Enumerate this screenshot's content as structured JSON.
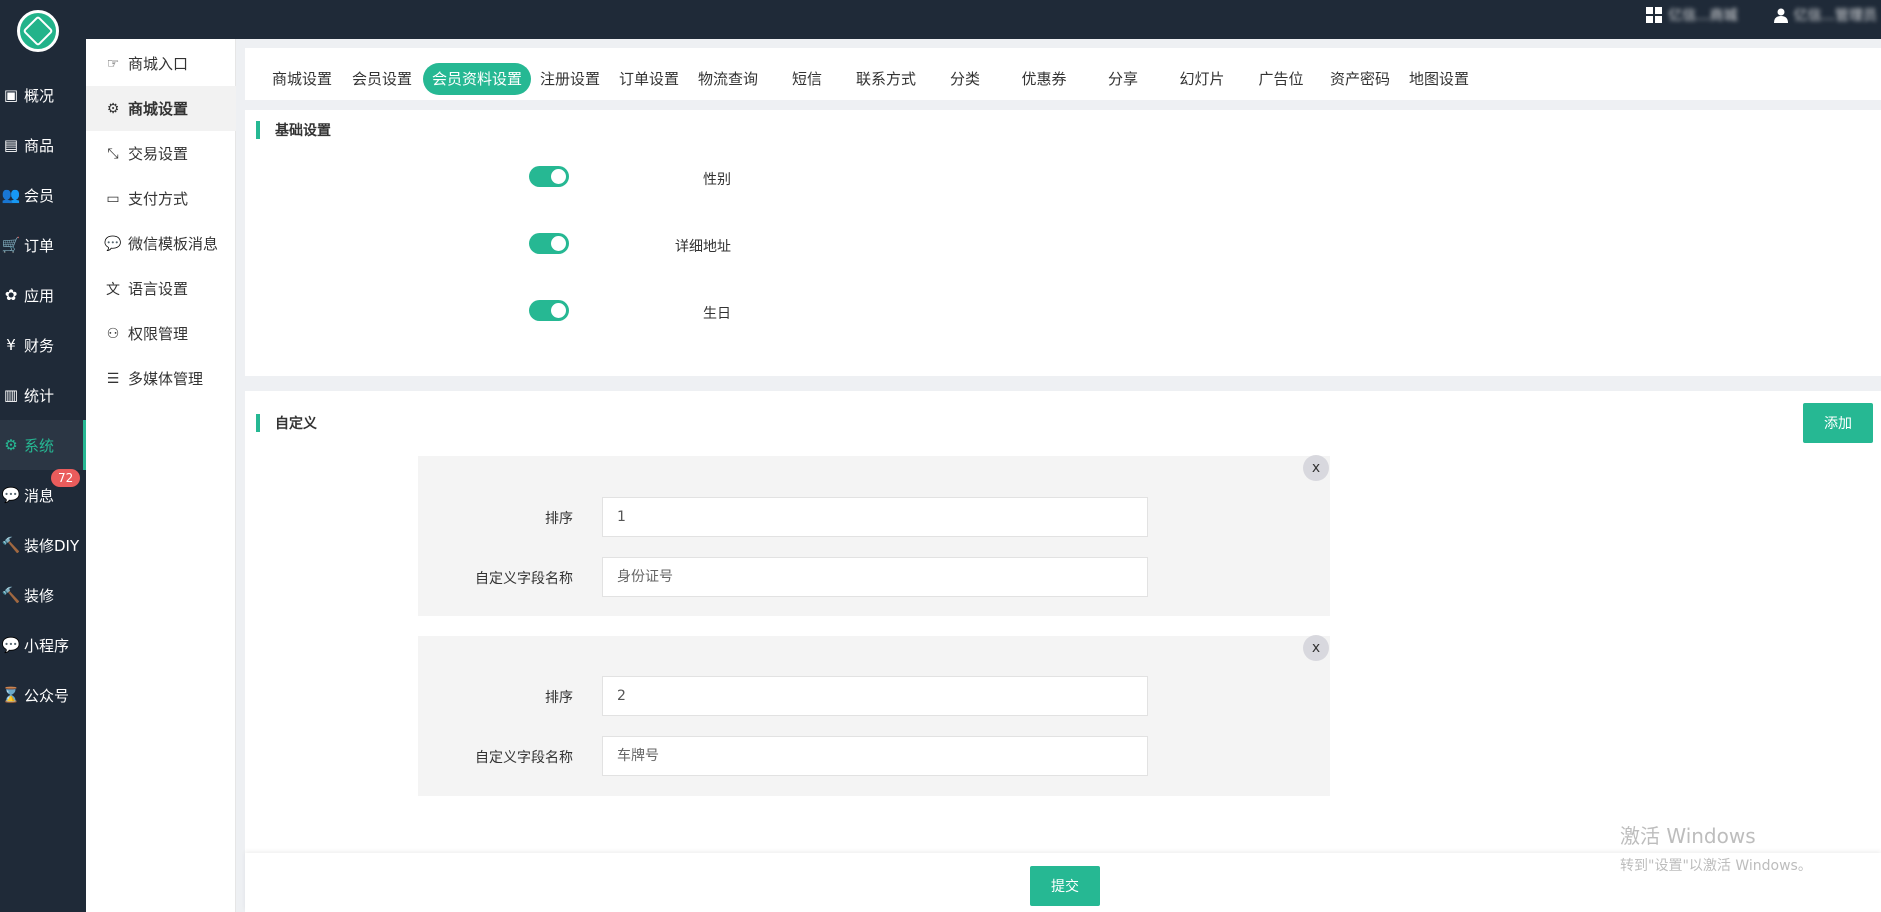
{
  "top": {
    "item1": "亿信...商城",
    "item2": "亿信...管理员"
  },
  "nav": [
    {
      "label": "概况"
    },
    {
      "label": "商品"
    },
    {
      "label": "会员"
    },
    {
      "label": "订单"
    },
    {
      "label": "应用"
    },
    {
      "label": "财务"
    },
    {
      "label": "统计"
    },
    {
      "label": "系统"
    },
    {
      "label": "消息"
    },
    {
      "label": "装修DIY"
    },
    {
      "label": "装修"
    },
    {
      "label": "小程序"
    },
    {
      "label": "公众号"
    }
  ],
  "message_badge": "72",
  "subnav": [
    {
      "label": "商城入口"
    },
    {
      "label": "商城设置"
    },
    {
      "label": "交易设置"
    },
    {
      "label": "支付方式"
    },
    {
      "label": "微信模板消息"
    },
    {
      "label": "语言设置"
    },
    {
      "label": "权限管理"
    },
    {
      "label": "多媒体管理"
    }
  ],
  "tabs": [
    {
      "label": "商城设置"
    },
    {
      "label": "会员设置"
    },
    {
      "label": "会员资料设置"
    },
    {
      "label": "注册设置"
    },
    {
      "label": "订单设置"
    },
    {
      "label": "物流查询"
    },
    {
      "label": "短信"
    },
    {
      "label": "联系方式"
    },
    {
      "label": "分类"
    },
    {
      "label": "优惠券"
    },
    {
      "label": "分享"
    },
    {
      "label": "幻灯片"
    },
    {
      "label": "广告位"
    },
    {
      "label": "资产密码"
    },
    {
      "label": "地图设置"
    }
  ],
  "basic": {
    "title": "基础设置",
    "switches": [
      {
        "label": "性别",
        "on": true
      },
      {
        "label": "详细地址",
        "on": true
      },
      {
        "label": "生日",
        "on": true
      }
    ]
  },
  "custom": {
    "title": "自定义",
    "add_label": "添加",
    "close_label": "x",
    "sort_label": "排序",
    "name_label": "自定义字段名称",
    "fields": [
      {
        "sort": "1",
        "name_placeholder": "身份证号"
      },
      {
        "sort": "2",
        "name_placeholder": "车牌号"
      }
    ]
  },
  "submit_label": "提交",
  "watermark": {
    "line1": "激活 Windows",
    "line2": "转到\"设置\"以激活 Windows。"
  },
  "colors": {
    "accent": "#26b893",
    "sidebar": "#1f2a38",
    "badge": "#ea5c5c"
  }
}
